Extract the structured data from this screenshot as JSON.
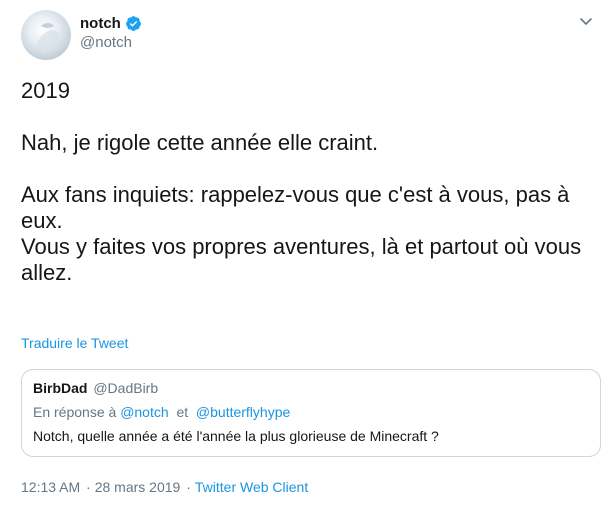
{
  "author": {
    "name": "notch",
    "handle": "@notch",
    "verified": true
  },
  "tweet": {
    "paragraphs": [
      "2019",
      "Nah, je rigole cette année elle craint.",
      "Aux fans inquiets: rappelez-vous que c'est à vous, pas à\neux.\nVous y faites vos propres aventures, là et partout où vous\nallez."
    ],
    "translate_label": "Traduire le Tweet"
  },
  "quote": {
    "name": "BirbDad",
    "handle": "@DadBirb",
    "reply_prefix": "En réponse à",
    "reply_to_1": "@notch",
    "reply_join": "et",
    "reply_to_2": "@butterflyhype",
    "text": "Notch, quelle année a été l'année la plus glorieuse de Minecraft ?"
  },
  "meta": {
    "time": "12:13 AM",
    "separator": "·",
    "date": "28 mars 2019",
    "client": "Twitter Web Client"
  },
  "colors": {
    "link": "#1b95e0",
    "muted": "#657786",
    "verified": "#1da1f2"
  },
  "icons": [
    "avatar",
    "verified-badge-icon",
    "chevron-down-icon"
  ]
}
